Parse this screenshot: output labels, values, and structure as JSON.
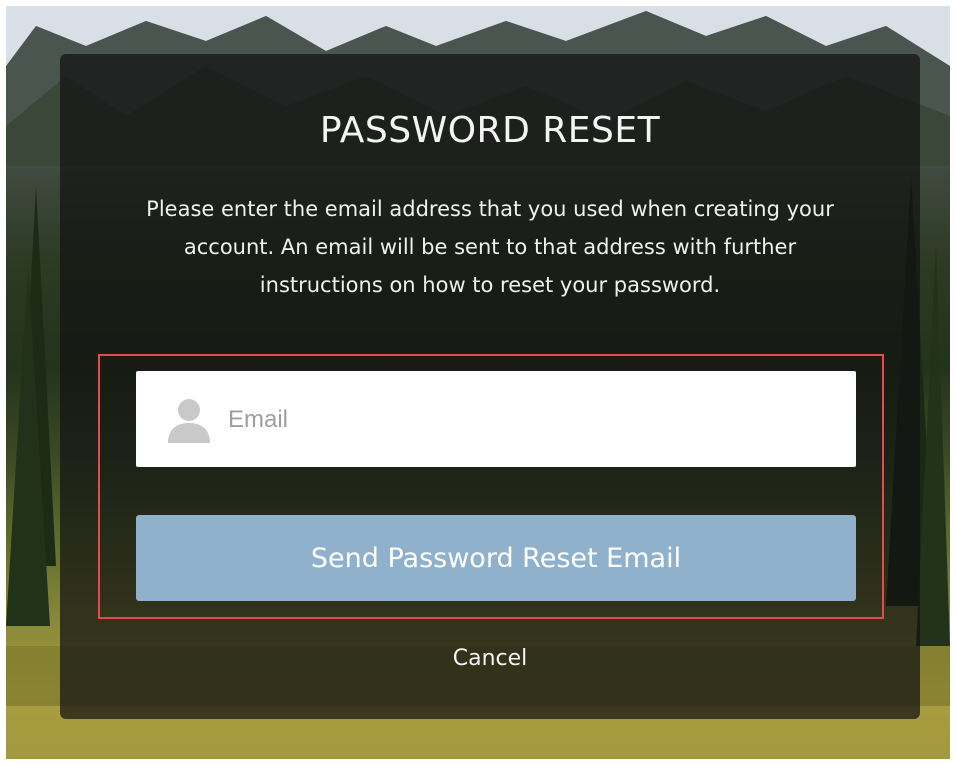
{
  "reset_form": {
    "title": "PASSWORD RESET",
    "description": "Please enter the email address that you used when creating your account. An email will be sent to that address with further instructions on how to reset your password.",
    "email": {
      "value": "",
      "placeholder": "Email",
      "icon": "user-icon"
    },
    "send_button_label": "Send Password Reset Email",
    "cancel_label": "Cancel"
  },
  "colors": {
    "highlight_border": "#e44b4b",
    "send_button_bg": "#8fb1cc",
    "panel_bg": "rgba(18,18,18,0.72)"
  }
}
